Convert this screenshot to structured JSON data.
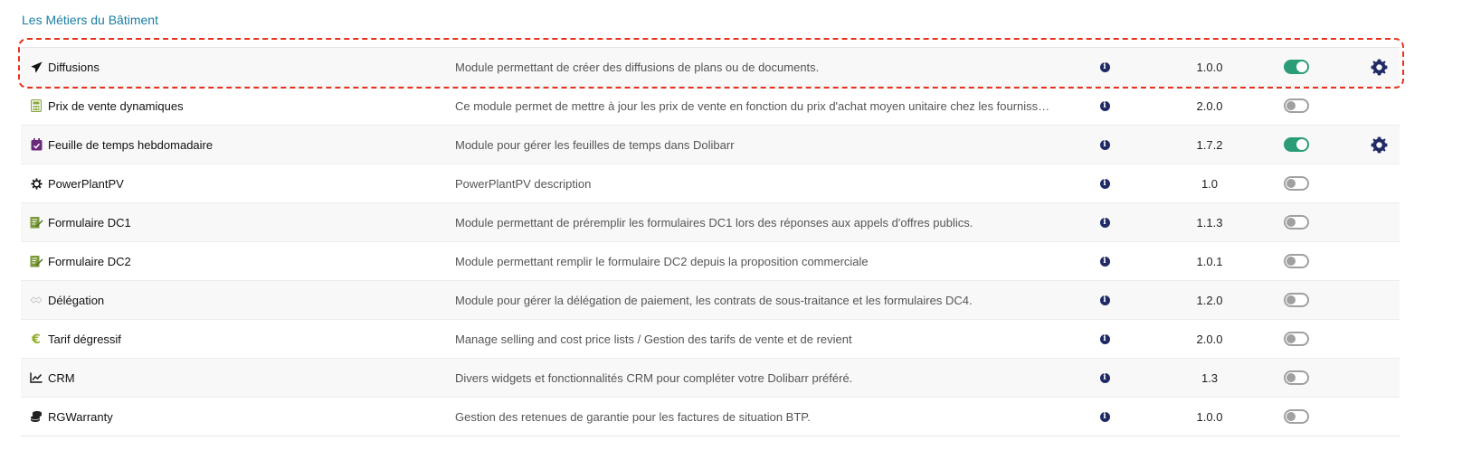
{
  "section": {
    "title": "Les Métiers du Bâtiment"
  },
  "modules": [
    {
      "name": "Diffusions",
      "icon": "paper-plane-icon",
      "description": "Module permettant de créer des diffusions de plans ou de documents.",
      "version": "1.0.0",
      "enabled": true,
      "has_settings": true
    },
    {
      "name": "Prix de vente dynamiques",
      "icon": "calculator-icon",
      "description": "Ce module permet de mettre à jour les prix de vente en fonction du prix d'achat moyen unitaire chez les fournisse…",
      "version": "2.0.0",
      "enabled": false,
      "has_settings": false
    },
    {
      "name": "Feuille de temps hebdomadaire",
      "icon": "calendar-check-icon",
      "description": "Module pour gérer les feuilles de temps dans Dolibarr",
      "version": "1.7.2",
      "enabled": true,
      "has_settings": true
    },
    {
      "name": "PowerPlantPV",
      "icon": "cog-small-icon",
      "description": "PowerPlantPV description",
      "version": "1.0",
      "enabled": false,
      "has_settings": false
    },
    {
      "name": "Formulaire DC1",
      "icon": "form-edit-icon",
      "description": "Module permettant de préremplir les formulaires DC1 lors des réponses aux appels d'offres publics.",
      "version": "1.1.3",
      "enabled": false,
      "has_settings": false
    },
    {
      "name": "Formulaire DC2",
      "icon": "form-edit-icon",
      "description": "Module permettant remplir le formulaire DC2 depuis la proposition commerciale",
      "version": "1.0.1",
      "enabled": false,
      "has_settings": false
    },
    {
      "name": "Délégation",
      "icon": "handshake-icon",
      "description": "Module pour gérer la délégation de paiement, les contrats de sous-traitance et les formulaires DC4.",
      "version": "1.2.0",
      "enabled": false,
      "has_settings": false
    },
    {
      "name": "Tarif dégressif",
      "icon": "euro-icon",
      "description": "Manage selling and cost price lists / Gestion des tarifs de vente et de revient",
      "version": "2.0.0",
      "enabled": false,
      "has_settings": false
    },
    {
      "name": "CRM",
      "icon": "line-chart-icon",
      "description": "Divers widgets et fonctionnalités CRM pour compléter votre Dolibarr préféré.",
      "version": "1.3",
      "enabled": false,
      "has_settings": false
    },
    {
      "name": "RGWarranty",
      "icon": "coins-icon",
      "description": "Gestion des retenues de garantie pour les factures de situation BTP.",
      "version": "1.0.0",
      "enabled": false,
      "has_settings": false
    }
  ],
  "colors": {
    "accent": "#1b7fa0",
    "toggle_on": "#2a9d78",
    "info": "#1f2a66",
    "highlight": "#e8321d"
  }
}
